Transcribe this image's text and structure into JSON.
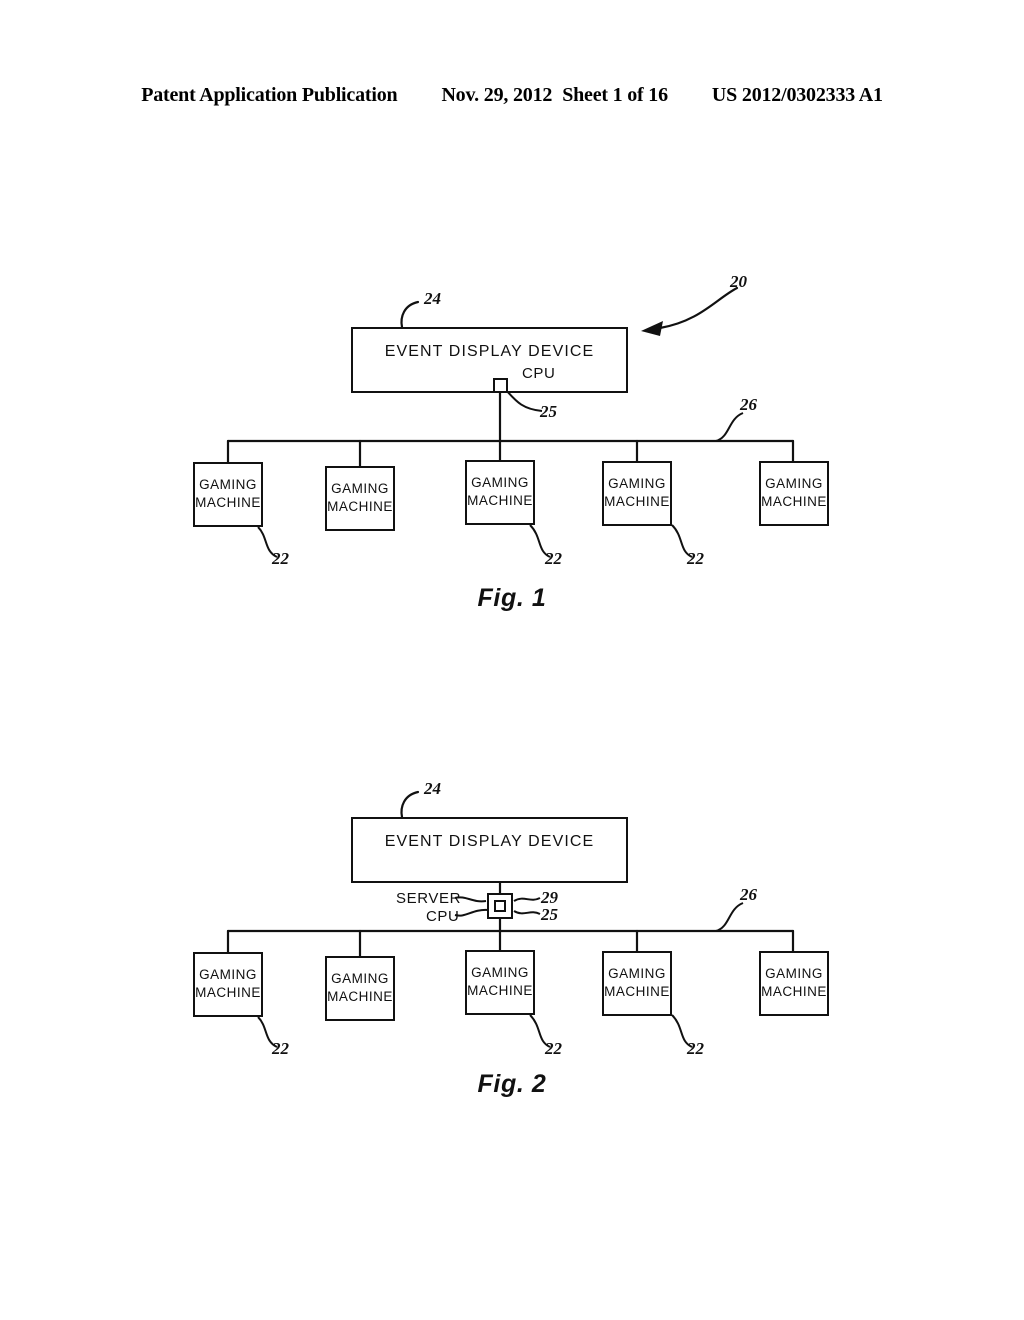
{
  "header": {
    "publication": "Patent Application Publication",
    "date": "Nov. 29, 2012",
    "sheet": "Sheet 1 of 16",
    "publication_number": "US 2012/0302333 A1"
  },
  "figures": [
    {
      "caption": "Fig. 1",
      "system_ref": "20",
      "network_ref": "26",
      "display_device": {
        "label": "EVENT DISPLAY DEVICE",
        "ref": "24"
      },
      "cpu": {
        "label": "CPU",
        "ref": "25"
      },
      "server": null,
      "gaming_machines": [
        {
          "label_line1": "GAMING",
          "label_line2": "MACHINE",
          "ref": "22"
        },
        {
          "label_line1": "GAMING",
          "label_line2": "MACHINE",
          "ref": ""
        },
        {
          "label_line1": "GAMING",
          "label_line2": "MACHINE",
          "ref": "22"
        },
        {
          "label_line1": "GAMING",
          "label_line2": "MACHINE",
          "ref": "22"
        },
        {
          "label_line1": "GAMING",
          "label_line2": "MACHINE",
          "ref": ""
        }
      ]
    },
    {
      "caption": "Fig. 2",
      "system_ref": "",
      "network_ref": "26",
      "display_device": {
        "label": "EVENT DISPLAY DEVICE",
        "ref": "24"
      },
      "cpu": {
        "label": "CPU",
        "ref": "25"
      },
      "server": {
        "label": "SERVER",
        "ref": "29"
      },
      "gaming_machines": [
        {
          "label_line1": "GAMING",
          "label_line2": "MACHINE",
          "ref": "22"
        },
        {
          "label_line1": "GAMING",
          "label_line2": "MACHINE",
          "ref": ""
        },
        {
          "label_line1": "GAMING",
          "label_line2": "MACHINE",
          "ref": "22"
        },
        {
          "label_line1": "GAMING",
          "label_line2": "MACHINE",
          "ref": "22"
        },
        {
          "label_line1": "GAMING",
          "label_line2": "MACHINE",
          "ref": ""
        }
      ]
    }
  ],
  "colors": {
    "ink": "#111111",
    "paper": "#ffffff"
  }
}
